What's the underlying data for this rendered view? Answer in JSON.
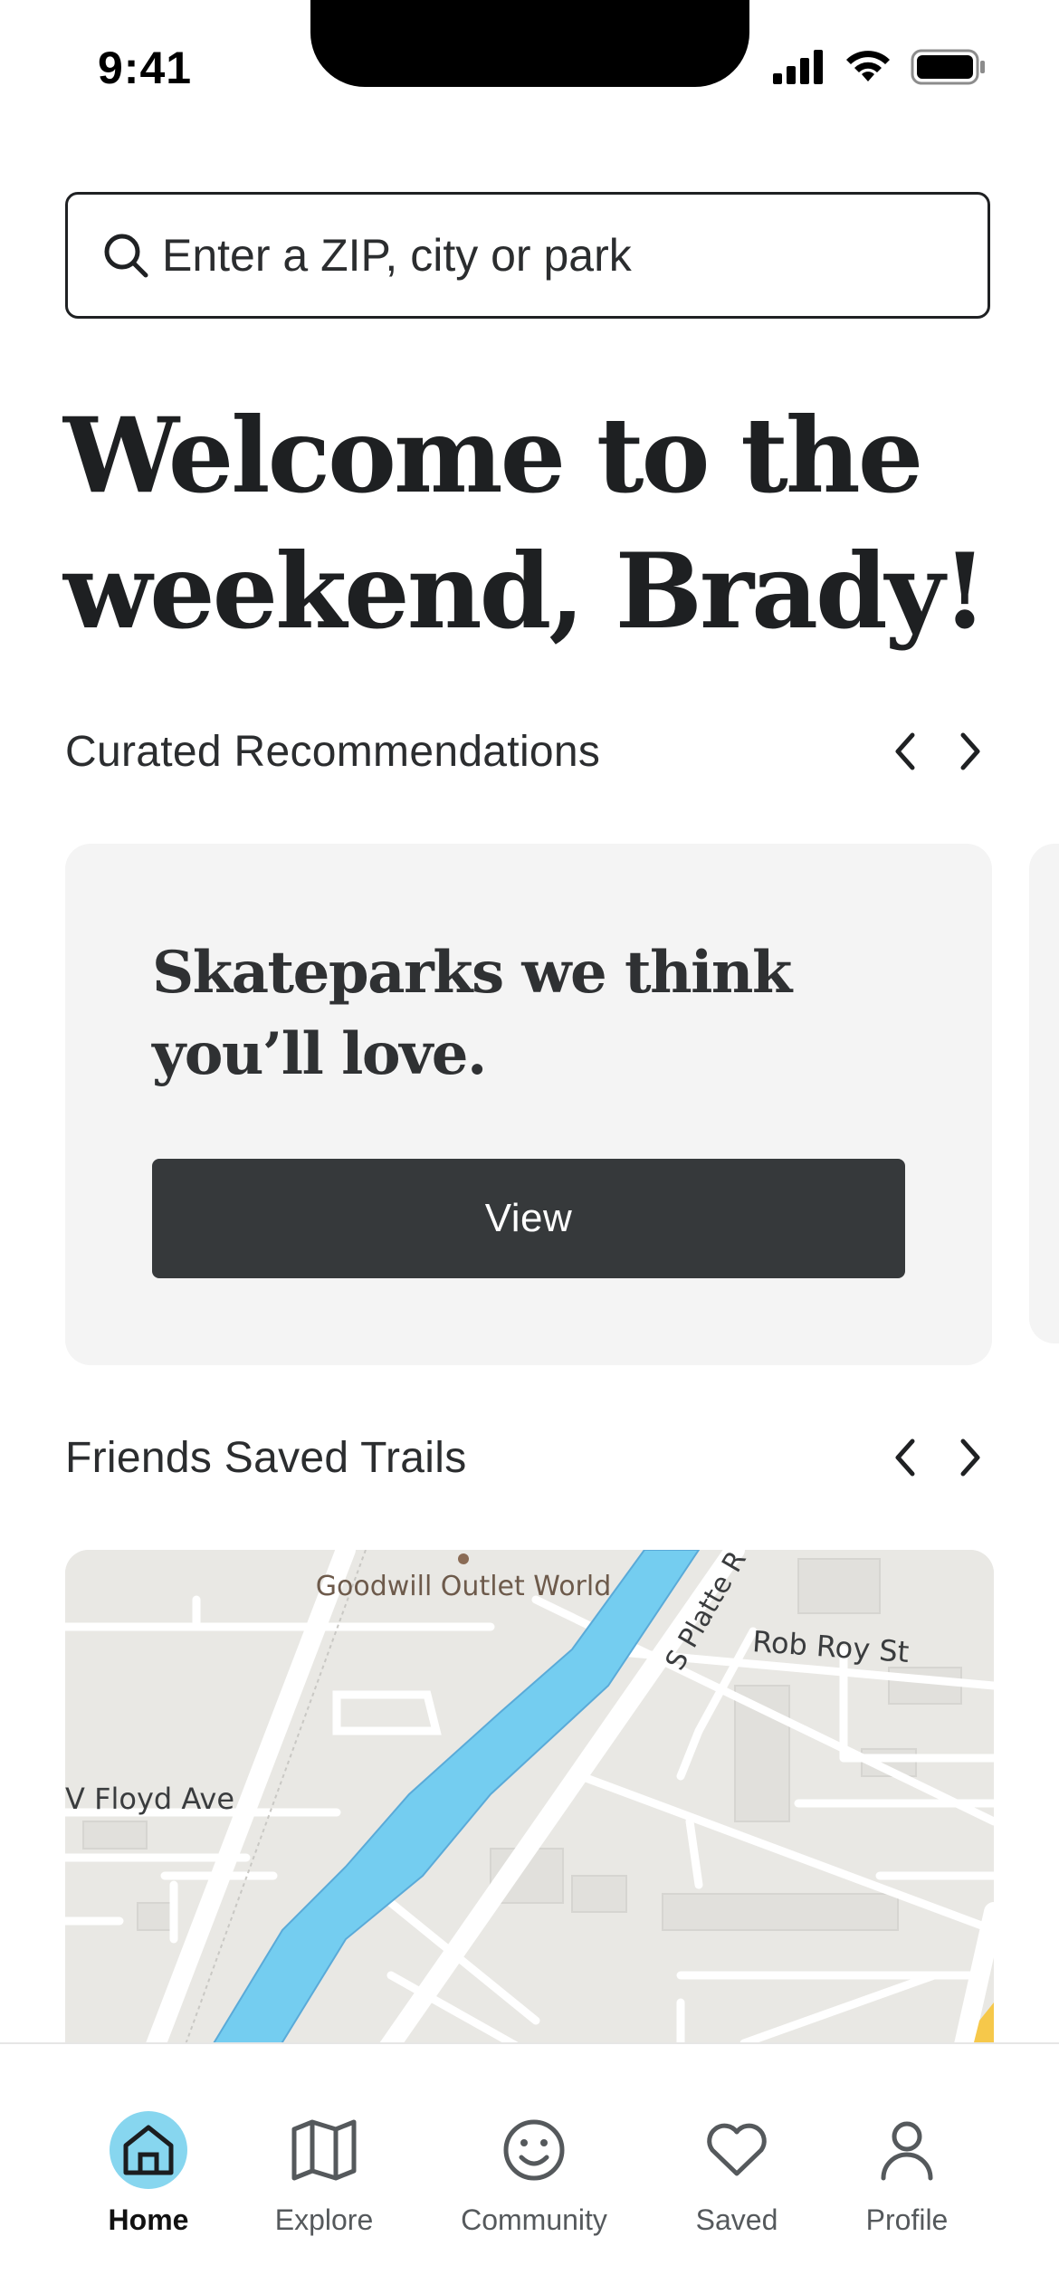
{
  "status_bar": {
    "time": "9:41"
  },
  "search": {
    "placeholder": "Enter a ZIP, city or park"
  },
  "welcome": {
    "title": "Welcome to the weekend, Brady!"
  },
  "curated": {
    "title": "Curated Recommendations",
    "card": {
      "title": "Skateparks we think you’ll love.",
      "button_label": "View"
    }
  },
  "friends_trails": {
    "title": "Friends Saved Trails",
    "map_labels": {
      "poi": "Goodwill Outlet World",
      "street_1": "S Platte R",
      "street_2": "Rob Roy St",
      "street_3": "V Floyd Ave"
    }
  },
  "nav": {
    "items": [
      {
        "label": "Home",
        "icon": "home-icon",
        "active": true
      },
      {
        "label": "Explore",
        "icon": "map-icon",
        "active": false
      },
      {
        "label": "Community",
        "icon": "smiley-icon",
        "active": false
      },
      {
        "label": "Saved",
        "icon": "heart-icon",
        "active": false
      },
      {
        "label": "Profile",
        "icon": "user-icon",
        "active": false
      }
    ]
  },
  "colors": {
    "accent": "#87d6ef",
    "button": "#36393b",
    "card": "#f4f4f4",
    "river": "#74cdf0"
  }
}
